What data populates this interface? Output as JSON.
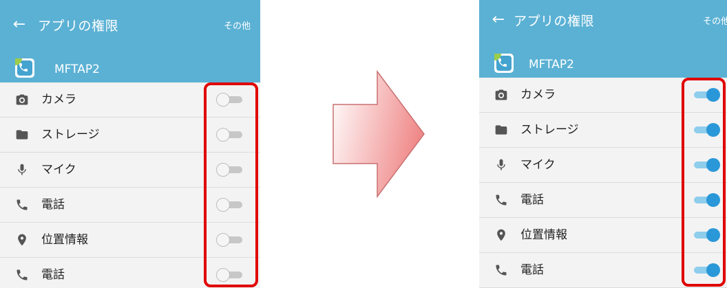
{
  "left": {
    "title": "アプリの権限",
    "more_label": "その他",
    "app_name": "MFTAP2",
    "permissions": [
      {
        "label": "カメラ",
        "icon": "camera-icon",
        "enabled": false
      },
      {
        "label": "ストレージ",
        "icon": "folder-icon",
        "enabled": false
      },
      {
        "label": "マイク",
        "icon": "microphone-icon",
        "enabled": false
      },
      {
        "label": "電話",
        "icon": "phone-icon",
        "enabled": false
      },
      {
        "label": "位置情報",
        "icon": "location-icon",
        "enabled": false
      },
      {
        "label": "電話",
        "icon": "phone-icon",
        "enabled": false
      }
    ]
  },
  "right": {
    "title": "アプリの権限",
    "more_label": "その他",
    "app_name": "MFTAP2",
    "permissions": [
      {
        "label": "カメラ",
        "icon": "camera-icon",
        "enabled": true
      },
      {
        "label": "ストレージ",
        "icon": "folder-icon",
        "enabled": true
      },
      {
        "label": "マイク",
        "icon": "microphone-icon",
        "enabled": true
      },
      {
        "label": "電話",
        "icon": "phone-icon",
        "enabled": true
      },
      {
        "label": "位置情報",
        "icon": "location-icon",
        "enabled": true
      },
      {
        "label": "電話",
        "icon": "phone-icon",
        "enabled": true
      }
    ]
  },
  "colors": {
    "header": "#5bb1d4",
    "highlight": "#e00000",
    "toggle_on": "#2a98d8",
    "arrow_gradient": [
      "#ffffff",
      "#f08a8a"
    ]
  }
}
